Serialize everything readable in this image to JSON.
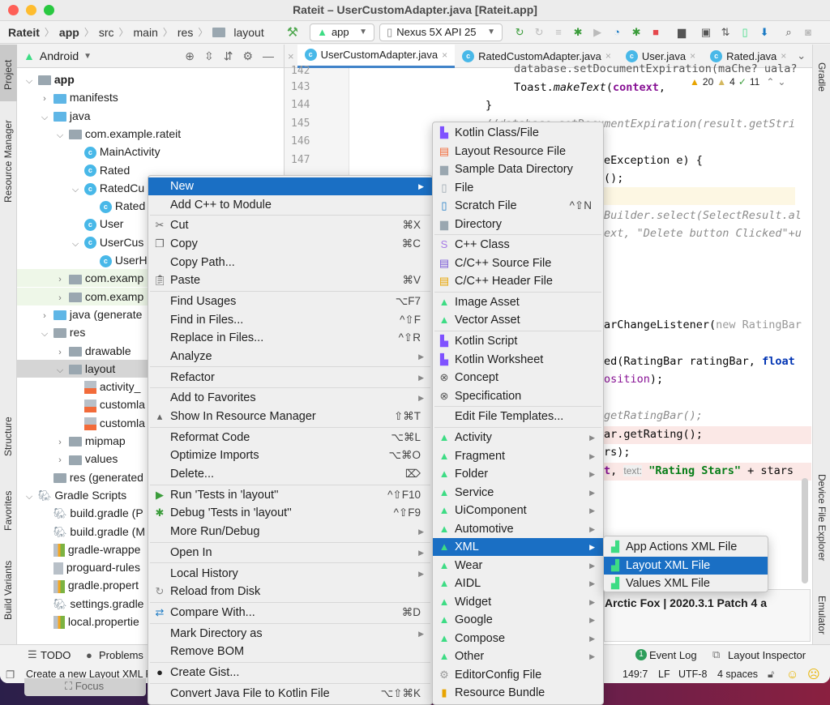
{
  "window": {
    "title": "Rateit – UserCustomAdapter.java [Rateit.app]",
    "traffic_lights": {
      "close": "#fe5f57",
      "minimize": "#febc2e",
      "zoom": "#28c840"
    }
  },
  "toolbar": {
    "breadcrumb": [
      "Rateit",
      "app",
      "src",
      "main",
      "res",
      "layout"
    ],
    "build_icon": "hammer-icon",
    "run_config": "app",
    "device": "Nexus 5X API 25",
    "icons": [
      "apply-changes-icon",
      "apply-code-changes-icon",
      "sync-icon",
      "debug-icon",
      "coverage-icon",
      "profile-icon",
      "attach-debugger-icon",
      "stop-icon",
      "project-structure-icon",
      "terminal-icon",
      "gradle-sync-icon",
      "avd-manager-icon",
      "sdk-manager-icon",
      "search-icon",
      "account-icon"
    ]
  },
  "left_strip": {
    "tabs": [
      "Project",
      "Resource Manager",
      "Structure",
      "Favorites",
      "Build Variants"
    ]
  },
  "right_strip": {
    "tabs": [
      "Gradle",
      "Device File Explorer",
      "Emulator"
    ]
  },
  "project_panel": {
    "view_selector": "Android",
    "tree": [
      {
        "label": "app",
        "level": 0,
        "expanded": true,
        "icon": "module",
        "bold": true
      },
      {
        "label": "manifests",
        "level": 1,
        "expanded": false,
        "icon": "folder-blue"
      },
      {
        "label": "java",
        "level": 1,
        "expanded": true,
        "icon": "folder-blue"
      },
      {
        "label": "com.example.rateit",
        "level": 2,
        "expanded": true,
        "icon": "package"
      },
      {
        "label": "MainActivity",
        "level": 3,
        "icon": "class"
      },
      {
        "label": "Rated",
        "level": 3,
        "icon": "class"
      },
      {
        "label": "RatedCu",
        "level": 3,
        "expanded": true,
        "icon": "class"
      },
      {
        "label": "Rated",
        "level": 4,
        "icon": "class"
      },
      {
        "label": "User",
        "level": 3,
        "icon": "class"
      },
      {
        "label": "UserCus",
        "level": 3,
        "expanded": true,
        "icon": "class"
      },
      {
        "label": "UserH",
        "level": 4,
        "icon": "class"
      },
      {
        "label": "com.examp",
        "level": 2,
        "expanded": false,
        "icon": "package",
        "test": true
      },
      {
        "label": "com.examp",
        "level": 2,
        "expanded": false,
        "icon": "package",
        "test": true
      },
      {
        "label": "java (generate",
        "level": 1,
        "expanded": false,
        "icon": "folder-generated"
      },
      {
        "label": "res",
        "level": 1,
        "expanded": true,
        "icon": "folder-res"
      },
      {
        "label": "drawable",
        "level": 2,
        "expanded": false,
        "icon": "package"
      },
      {
        "label": "layout",
        "level": 2,
        "expanded": true,
        "icon": "package",
        "selected": true
      },
      {
        "label": "activity_",
        "level": 3,
        "icon": "xml"
      },
      {
        "label": "customla",
        "level": 3,
        "icon": "xml"
      },
      {
        "label": "customla",
        "level": 3,
        "icon": "xml"
      },
      {
        "label": "mipmap",
        "level": 2,
        "expanded": false,
        "icon": "package"
      },
      {
        "label": "values",
        "level": 2,
        "expanded": false,
        "icon": "package"
      },
      {
        "label": "res (generated",
        "level": 1,
        "icon": "folder-res"
      },
      {
        "label": "Gradle Scripts",
        "level": 0,
        "expanded": true,
        "icon": "gradle"
      },
      {
        "label": "build.gradle (P",
        "level": 1,
        "icon": "gradle"
      },
      {
        "label": "build.gradle (M",
        "level": 1,
        "icon": "gradle"
      },
      {
        "label": "gradle-wrappe",
        "level": 1,
        "icon": "properties"
      },
      {
        "label": "proguard-rules",
        "level": 1,
        "icon": "text"
      },
      {
        "label": "gradle.propert",
        "level": 1,
        "icon": "properties"
      },
      {
        "label": "settings.gradle",
        "level": 1,
        "icon": "gradle"
      },
      {
        "label": "local.propertie",
        "level": 1,
        "icon": "properties"
      }
    ]
  },
  "editor": {
    "tabs": [
      {
        "label": "UserCustomAdapter.java",
        "active": true
      },
      {
        "label": "RatedCustomAdapter.java"
      },
      {
        "label": "User.java"
      },
      {
        "label": "Rated.java"
      }
    ],
    "inspections": {
      "errors": "20",
      "warnings": "4",
      "ok": "11"
    },
    "line_numbers": [
      "142",
      "143",
      "144",
      "145",
      "146",
      "147"
    ],
    "code_lines": {
      "l142": "database.setDocumentExpiration(maChe? uala?",
      "l143a": "Toast.",
      "l143b": "makeText",
      "l143c": "(",
      "l143d": "context",
      "l143e": ",",
      "l144": "}",
      "l145": "//database.setDocumentExpiration(result.getStri",
      "l147a": "eException e) {",
      "l148": "();",
      "l151": "Builder.select(SelectResult.al",
      "l152": "ext, \"Delete button Clicked\"+u",
      "l157a": "arChangeListener(",
      "l157b": "new RatingBar",
      "l159a": "ed(RatingBar ratingBar, ",
      "l159b": "float",
      "l160a": "osition",
      "l160b": ");",
      "l162": "getRatingBar();",
      "l163": "ar.getRating();",
      "l164": "rs);",
      "l165a": "t",
      "l165b": ", ",
      "l165c": "text:",
      "l165d": " \"Rating Stars\"",
      "l165e": " + stars"
    }
  },
  "context_menu": {
    "items": [
      {
        "label": "New",
        "submenu": true,
        "selected": true
      },
      {
        "label": "Add C++ to Module",
        "sep_after": true
      },
      {
        "label": "Cut",
        "shortcut": "⌘X",
        "icon": "cut-icon"
      },
      {
        "label": "Copy",
        "shortcut": "⌘C",
        "icon": "copy-icon"
      },
      {
        "label": "Copy Path..."
      },
      {
        "label": "Paste",
        "shortcut": "⌘V",
        "icon": "paste-icon",
        "sep_after": true
      },
      {
        "label": "Find Usages",
        "shortcut": "⌥F7"
      },
      {
        "label": "Find in Files...",
        "shortcut": "^⇧F"
      },
      {
        "label": "Replace in Files...",
        "shortcut": "^⇧R"
      },
      {
        "label": "Analyze",
        "submenu": true,
        "sep_after": true
      },
      {
        "label": "Refactor",
        "submenu": true,
        "sep_after": true
      },
      {
        "label": "Add to Favorites",
        "submenu": true
      },
      {
        "label": "Show In Resource Manager",
        "shortcut": "⇧⌘T",
        "icon": "resource-manager-icon",
        "sep_after": true
      },
      {
        "label": "Reformat Code",
        "shortcut": "⌥⌘L"
      },
      {
        "label": "Optimize Imports",
        "shortcut": "⌥⌘O"
      },
      {
        "label": "Delete...",
        "shortcut": "⌦",
        "sep_after": true
      },
      {
        "label": "Run 'Tests in 'layout''",
        "shortcut": "^⇧F10",
        "icon": "run-icon"
      },
      {
        "label": "Debug 'Tests in 'layout''",
        "shortcut": "^⇧F9",
        "icon": "debug-icon"
      },
      {
        "label": "More Run/Debug",
        "submenu": true,
        "sep_after": true
      },
      {
        "label": "Open In",
        "submenu": true,
        "sep_after": true
      },
      {
        "label": "Local History",
        "submenu": true
      },
      {
        "label": "Reload from Disk",
        "icon": "reload-icon",
        "sep_after": true
      },
      {
        "label": "Compare With...",
        "shortcut": "⌘D",
        "icon": "compare-icon",
        "sep_after": true
      },
      {
        "label": "Mark Directory as",
        "submenu": true
      },
      {
        "label": "Remove BOM",
        "sep_after": true
      },
      {
        "label": "Create Gist...",
        "icon": "github-icon",
        "sep_after": true
      },
      {
        "label": "Convert Java File to Kotlin File",
        "shortcut": "⌥⇧⌘K"
      }
    ]
  },
  "new_submenu": {
    "items": [
      {
        "label": "Kotlin Class/File",
        "icon": "kotlin-file-icon"
      },
      {
        "label": "Layout Resource File",
        "icon": "layout-file-icon"
      },
      {
        "label": "Sample Data Directory",
        "icon": "folder-icon"
      },
      {
        "label": "File",
        "icon": "file-icon"
      },
      {
        "label": "Scratch File",
        "shortcut": "^⇧N",
        "icon": "scratch-file-icon"
      },
      {
        "label": "Directory",
        "icon": "folder-icon",
        "sep_after": true
      },
      {
        "label": "C++ Class",
        "icon": "cpp-class-icon"
      },
      {
        "label": "C/C++ Source File",
        "icon": "cpp-source-icon"
      },
      {
        "label": "C/C++ Header File",
        "icon": "cpp-header-icon",
        "sep_after": true
      },
      {
        "label": "Image Asset",
        "icon": "android-icon"
      },
      {
        "label": "Vector Asset",
        "icon": "android-icon",
        "sep_after": true
      },
      {
        "label": "Kotlin Script",
        "icon": "kotlin-file-icon"
      },
      {
        "label": "Kotlin Worksheet",
        "icon": "kotlin-file-icon"
      },
      {
        "label": "Concept",
        "icon": "concept-icon"
      },
      {
        "label": "Specification",
        "icon": "concept-icon",
        "sep_after": true
      },
      {
        "label": "Edit File Templates...",
        "sep_after": true
      },
      {
        "label": "Activity",
        "submenu": true,
        "icon": "android-icon"
      },
      {
        "label": "Fragment",
        "submenu": true,
        "icon": "android-icon"
      },
      {
        "label": "Folder",
        "submenu": true,
        "icon": "android-icon"
      },
      {
        "label": "Service",
        "submenu": true,
        "icon": "android-icon"
      },
      {
        "label": "UiComponent",
        "submenu": true,
        "icon": "android-icon"
      },
      {
        "label": "Automotive",
        "submenu": true,
        "icon": "android-icon"
      },
      {
        "label": "XML",
        "submenu": true,
        "icon": "android-icon",
        "selected": true
      },
      {
        "label": "Wear",
        "submenu": true,
        "icon": "android-icon"
      },
      {
        "label": "AIDL",
        "submenu": true,
        "icon": "android-icon"
      },
      {
        "label": "Widget",
        "submenu": true,
        "icon": "android-icon"
      },
      {
        "label": "Google",
        "submenu": true,
        "icon": "android-icon"
      },
      {
        "label": "Compose",
        "submenu": true,
        "icon": "android-icon"
      },
      {
        "label": "Other",
        "submenu": true,
        "icon": "android-icon"
      },
      {
        "label": "EditorConfig File",
        "icon": "gear-icon"
      },
      {
        "label": "Resource Bundle",
        "icon": "properties-icon"
      }
    ]
  },
  "xml_submenu": {
    "items": [
      {
        "label": "App Actions XML File"
      },
      {
        "label": "Layout XML File",
        "selected": true
      },
      {
        "label": "Values XML File"
      }
    ]
  },
  "notification": {
    "text": "Arctic Fox | 2020.3.1 Patch 4 a"
  },
  "bottom_tools": {
    "left": [
      {
        "label": "TODO",
        "icon": "list-icon"
      },
      {
        "label": "Problems",
        "icon": "problems-icon"
      }
    ],
    "right": [
      {
        "label": "Event Log",
        "badge": "1"
      },
      {
        "label": "Layout Inspector",
        "icon": "layout-inspector-icon"
      }
    ]
  },
  "statusbar": {
    "message": "Create a new Layout XML Fi",
    "position": "149:7",
    "line_sep": "LF",
    "encoding": "UTF-8",
    "indent": "4 spaces"
  },
  "dock": {
    "focus_label": "Focus"
  },
  "colors": {
    "selection": "#1a6fc4",
    "android_green": "#3ddc84",
    "accent_tab": "#4083c9"
  }
}
